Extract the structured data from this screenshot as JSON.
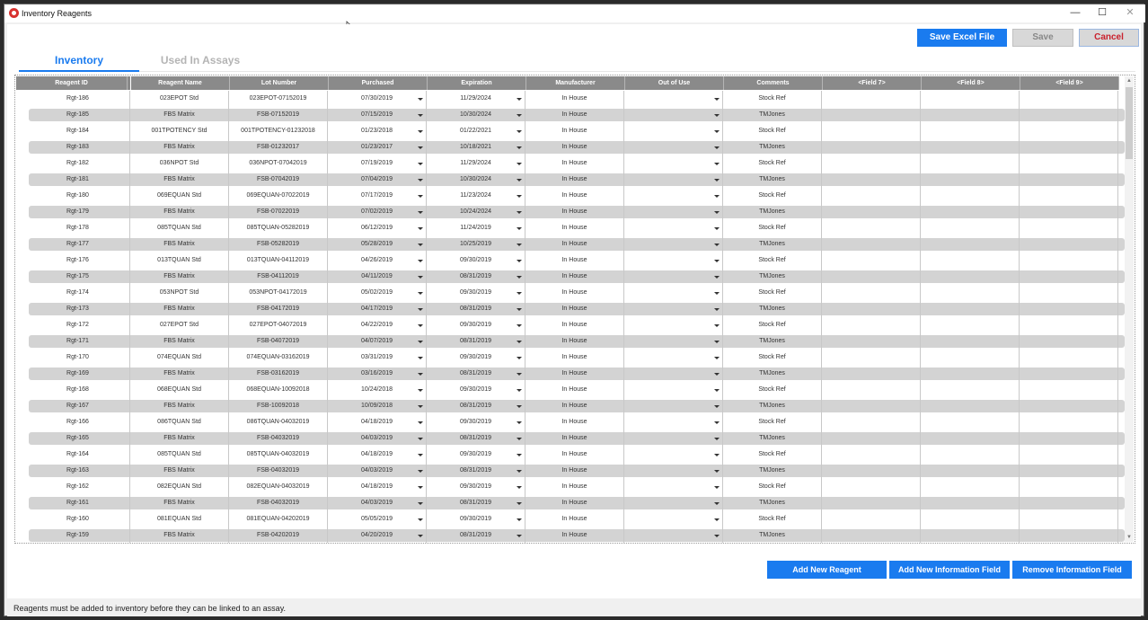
{
  "window": {
    "title": "Inventory Reagents",
    "minimize_glyph": "—",
    "maximize_glyph": "☐",
    "close_glyph": "✕"
  },
  "toolbar": {
    "save_excel_label": "Save Excel File",
    "save_label": "Save",
    "cancel_label": "Cancel"
  },
  "tabs": [
    {
      "label": "Inventory",
      "active": true
    },
    {
      "label": "Used In Assays",
      "active": false
    }
  ],
  "columns": [
    "Reagent ID",
    "Reagent Name",
    "Lot Number",
    "Purchased",
    "Expiration",
    "Manufacturer",
    "Out of Use",
    "Comments",
    "<Field 7>",
    "<Field 8>",
    "<Field 9>"
  ],
  "rows": [
    {
      "id": "Rgt-186",
      "name": "023EPOT Std",
      "lot": "023EPOT-07152019",
      "purchased": "07/30/2019",
      "expiration": "11/29/2024",
      "manufacturer": "In House",
      "out_of_use": "",
      "comments": "Stock Ref"
    },
    {
      "id": "Rgt-185",
      "name": "FBS Matrix",
      "lot": "FSB-07152019",
      "purchased": "07/15/2019",
      "expiration": "10/30/2024",
      "manufacturer": "In House",
      "out_of_use": "",
      "comments": "TMJones"
    },
    {
      "id": "Rgt-184",
      "name": "001TPOTENCY Std",
      "lot": "001TPOTENCY-01232018",
      "purchased": "01/23/2018",
      "expiration": "01/22/2021",
      "manufacturer": "In House",
      "out_of_use": "",
      "comments": "Stock Ref"
    },
    {
      "id": "Rgt-183",
      "name": "FBS Matrix",
      "lot": "FSB-01232017",
      "purchased": "01/23/2017",
      "expiration": "10/18/2021",
      "manufacturer": "In House",
      "out_of_use": "",
      "comments": "TMJones"
    },
    {
      "id": "Rgt-182",
      "name": "036NPOT Std",
      "lot": "036NPOT-07042019",
      "purchased": "07/19/2019",
      "expiration": "11/29/2024",
      "manufacturer": "In House",
      "out_of_use": "",
      "comments": "Stock Ref"
    },
    {
      "id": "Rgt-181",
      "name": "FBS Matrix",
      "lot": "FSB-07042019",
      "purchased": "07/04/2019",
      "expiration": "10/30/2024",
      "manufacturer": "In House",
      "out_of_use": "",
      "comments": "TMJones"
    },
    {
      "id": "Rgt-180",
      "name": "069EQUAN Std",
      "lot": "069EQUAN-07022019",
      "purchased": "07/17/2019",
      "expiration": "11/23/2024",
      "manufacturer": "In House",
      "out_of_use": "",
      "comments": "Stock Ref"
    },
    {
      "id": "Rgt-179",
      "name": "FBS Matrix",
      "lot": "FSB-07022019",
      "purchased": "07/02/2019",
      "expiration": "10/24/2024",
      "manufacturer": "In House",
      "out_of_use": "",
      "comments": "TMJones"
    },
    {
      "id": "Rgt-178",
      "name": "085TQUAN Std",
      "lot": "085TQUAN-05282019",
      "purchased": "06/12/2019",
      "expiration": "11/24/2019",
      "manufacturer": "In House",
      "out_of_use": "",
      "comments": "Stock Ref"
    },
    {
      "id": "Rgt-177",
      "name": "FBS Matrix",
      "lot": "FSB-05282019",
      "purchased": "05/28/2019",
      "expiration": "10/25/2019",
      "manufacturer": "In House",
      "out_of_use": "",
      "comments": "TMJones"
    },
    {
      "id": "Rgt-176",
      "name": "013TQUAN Std",
      "lot": "013TQUAN-04112019",
      "purchased": "04/26/2019",
      "expiration": "09/30/2019",
      "manufacturer": "In House",
      "out_of_use": "",
      "comments": "Stock Ref"
    },
    {
      "id": "Rgt-175",
      "name": "FBS Matrix",
      "lot": "FSB-04112019",
      "purchased": "04/11/2019",
      "expiration": "08/31/2019",
      "manufacturer": "In House",
      "out_of_use": "",
      "comments": "TMJones"
    },
    {
      "id": "Rgt-174",
      "name": "053NPOT Std",
      "lot": "053NPOT-04172019",
      "purchased": "05/02/2019",
      "expiration": "09/30/2019",
      "manufacturer": "In House",
      "out_of_use": "",
      "comments": "Stock Ref"
    },
    {
      "id": "Rgt-173",
      "name": "FBS Matrix",
      "lot": "FSB-04172019",
      "purchased": "04/17/2019",
      "expiration": "08/31/2019",
      "manufacturer": "In House",
      "out_of_use": "",
      "comments": "TMJones"
    },
    {
      "id": "Rgt-172",
      "name": "027EPOT Std",
      "lot": "027EPOT-04072019",
      "purchased": "04/22/2019",
      "expiration": "09/30/2019",
      "manufacturer": "In House",
      "out_of_use": "",
      "comments": "Stock Ref"
    },
    {
      "id": "Rgt-171",
      "name": "FBS Matrix",
      "lot": "FSB-04072019",
      "purchased": "04/07/2019",
      "expiration": "08/31/2019",
      "manufacturer": "In House",
      "out_of_use": "",
      "comments": "TMJones"
    },
    {
      "id": "Rgt-170",
      "name": "074EQUAN Std",
      "lot": "074EQUAN-03162019",
      "purchased": "03/31/2019",
      "expiration": "09/30/2019",
      "manufacturer": "In House",
      "out_of_use": "",
      "comments": "Stock Ref"
    },
    {
      "id": "Rgt-169",
      "name": "FBS Matrix",
      "lot": "FSB-03162019",
      "purchased": "03/16/2019",
      "expiration": "08/31/2019",
      "manufacturer": "In House",
      "out_of_use": "",
      "comments": "TMJones"
    },
    {
      "id": "Rgt-168",
      "name": "068EQUAN Std",
      "lot": "068EQUAN-10092018",
      "purchased": "10/24/2018",
      "expiration": "09/30/2019",
      "manufacturer": "In House",
      "out_of_use": "",
      "comments": "Stock Ref"
    },
    {
      "id": "Rgt-167",
      "name": "FBS Matrix",
      "lot": "FSB-10092018",
      "purchased": "10/09/2018",
      "expiration": "08/31/2019",
      "manufacturer": "In House",
      "out_of_use": "",
      "comments": "TMJones"
    },
    {
      "id": "Rgt-166",
      "name": "086TQUAN Std",
      "lot": "086TQUAN-04032019",
      "purchased": "04/18/2019",
      "expiration": "09/30/2019",
      "manufacturer": "In House",
      "out_of_use": "",
      "comments": "Stock Ref"
    },
    {
      "id": "Rgt-165",
      "name": "FBS Matrix",
      "lot": "FSB-04032019",
      "purchased": "04/03/2019",
      "expiration": "08/31/2019",
      "manufacturer": "In House",
      "out_of_use": "",
      "comments": "TMJones"
    },
    {
      "id": "Rgt-164",
      "name": "085TQUAN Std",
      "lot": "085TQUAN-04032019",
      "purchased": "04/18/2019",
      "expiration": "09/30/2019",
      "manufacturer": "In House",
      "out_of_use": "",
      "comments": "Stock Ref"
    },
    {
      "id": "Rgt-163",
      "name": "FBS Matrix",
      "lot": "FSB-04032019",
      "purchased": "04/03/2019",
      "expiration": "08/31/2019",
      "manufacturer": "In House",
      "out_of_use": "",
      "comments": "TMJones"
    },
    {
      "id": "Rgt-162",
      "name": "082EQUAN Std",
      "lot": "082EQUAN-04032019",
      "purchased": "04/18/2019",
      "expiration": "09/30/2019",
      "manufacturer": "In House",
      "out_of_use": "",
      "comments": "Stock Ref"
    },
    {
      "id": "Rgt-161",
      "name": "FBS Matrix",
      "lot": "FSB-04032019",
      "purchased": "04/03/2019",
      "expiration": "08/31/2019",
      "manufacturer": "In House",
      "out_of_use": "",
      "comments": "TMJones"
    },
    {
      "id": "Rgt-160",
      "name": "081EQUAN Std",
      "lot": "081EQUAN-04202019",
      "purchased": "05/05/2019",
      "expiration": "09/30/2019",
      "manufacturer": "In House",
      "out_of_use": "",
      "comments": "Stock Ref"
    },
    {
      "id": "Rgt-159",
      "name": "FBS Matrix",
      "lot": "FSB-04202019",
      "purchased": "04/20/2019",
      "expiration": "08/31/2019",
      "manufacturer": "In House",
      "out_of_use": "",
      "comments": "TMJones"
    }
  ],
  "buttons": {
    "add_reagent_label": "Add New Reagent",
    "add_field_label": "Add New Information Field",
    "remove_field_label": "Remove Information Field"
  },
  "status": "Reagents must be added to inventory before they can be linked to an assay."
}
